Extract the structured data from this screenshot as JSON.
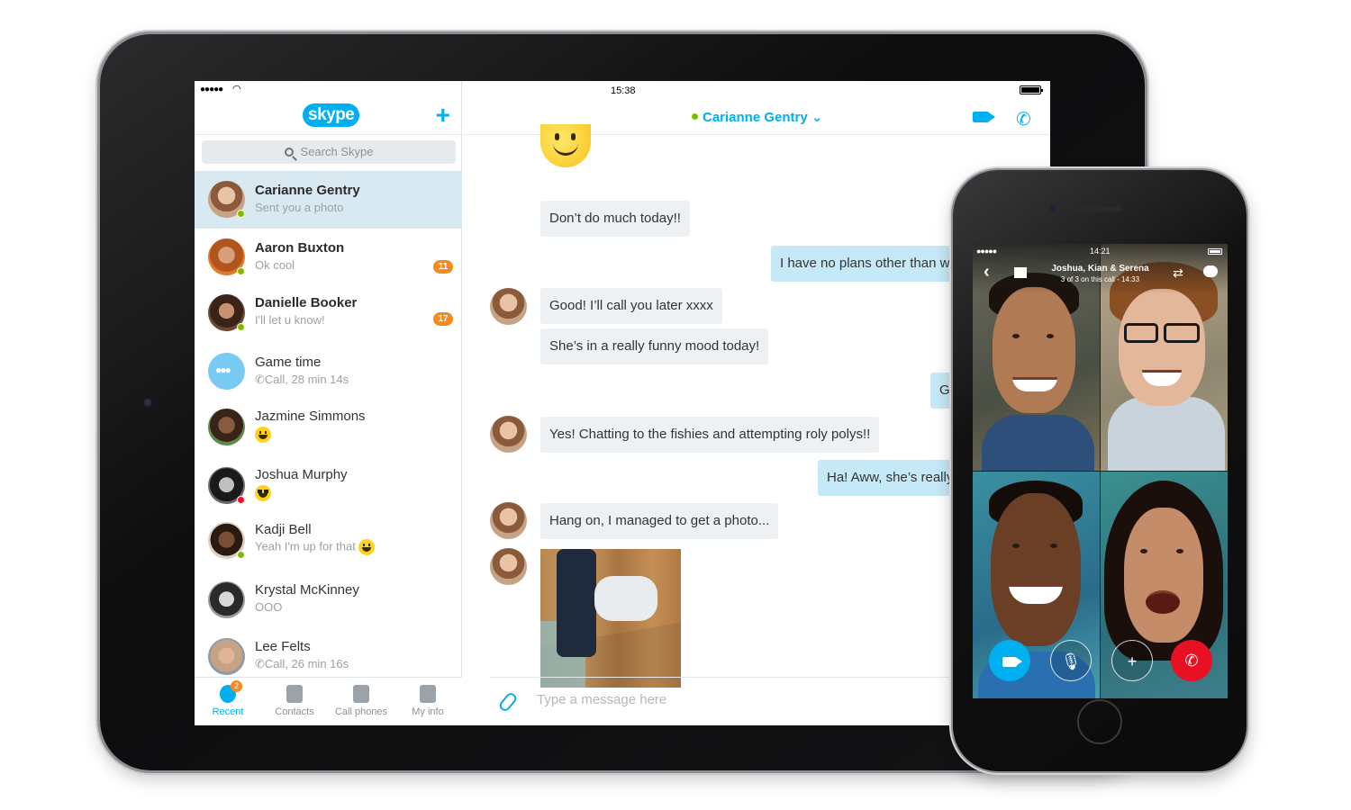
{
  "ipad": {
    "status": {
      "signal": "●●●●●",
      "time": "15:38"
    },
    "sidebar": {
      "logo": "skype",
      "add_icon": "plus-icon",
      "search_placeholder": "Search Skype",
      "conversations": [
        {
          "name": "Carianne Gentry",
          "subtitle": "Sent you a photo",
          "unread": false,
          "presence": "online"
        },
        {
          "name": "Aaron Buxton",
          "subtitle": "Ok cool",
          "badge": "11",
          "unread": true,
          "presence": "online"
        },
        {
          "name": "Danielle Booker",
          "subtitle": "I'll let u know!",
          "badge": "17",
          "unread": true,
          "presence": "online"
        },
        {
          "name": "Game time",
          "subtitle": "Call, 28 min 14s",
          "presence": "none"
        },
        {
          "name": "Jazmine Simmons",
          "subtitle": "",
          "emoji": "grin-emoji",
          "presence": "none"
        },
        {
          "name": "Joshua Murphy",
          "subtitle": "",
          "emoji": "sunglasses-emoji",
          "presence": "busy"
        },
        {
          "name": "Kadji Bell",
          "subtitle": "Yeah I'm up for that",
          "emoji": "smile-emoji",
          "presence": "online"
        },
        {
          "name": "Krystal McKinney",
          "subtitle": "OOO",
          "presence": "none"
        },
        {
          "name": "Lee Felts",
          "subtitle": "Call, 26 min 16s",
          "presence": "none"
        }
      ],
      "tabs": [
        {
          "label": "Recent",
          "badge": "2",
          "icon": "clock-icon",
          "active": true
        },
        {
          "label": "Contacts",
          "icon": "contacts-book-icon"
        },
        {
          "label": "Call phones",
          "icon": "dialpad-phone-icon"
        },
        {
          "label": "My info",
          "icon": "person-icon"
        }
      ]
    },
    "chat": {
      "contact": "Carianne Gentry",
      "messages": [
        {
          "dir": "in",
          "text": "Don’t do much today!!"
        },
        {
          "dir": "out",
          "text": "I have no plans other than wa"
        },
        {
          "dir": "in",
          "text": "Good! I’ll call you later xxxx"
        },
        {
          "dir": "in",
          "text": "She’s in a really funny mood today!"
        },
        {
          "dir": "out",
          "text": "Got"
        },
        {
          "dir": "in",
          "text": "Yes! Chatting to the fishies and attempting roly polys!!"
        },
        {
          "dir": "out",
          "text": "Ha! Aww, she’s really g"
        },
        {
          "dir": "in",
          "text": "Hang on, I managed to get a photo..."
        }
      ],
      "composer_placeholder": "Type a message here"
    }
  },
  "iphone": {
    "status": {
      "signal": "●●●●●",
      "time": "14:21"
    },
    "call_title": "Joshua, Kian & Serena",
    "call_subtitle": "3 of 3 on this call - 14:33",
    "controls": [
      "video-icon",
      "mute-mic-icon",
      "add-people-icon",
      "end-call-icon"
    ]
  },
  "colors": {
    "accent": "#00aff0",
    "badge": "#f58a1f",
    "online": "#7fba00",
    "busy": "#e81123",
    "active_row": "#d9e9f1"
  }
}
